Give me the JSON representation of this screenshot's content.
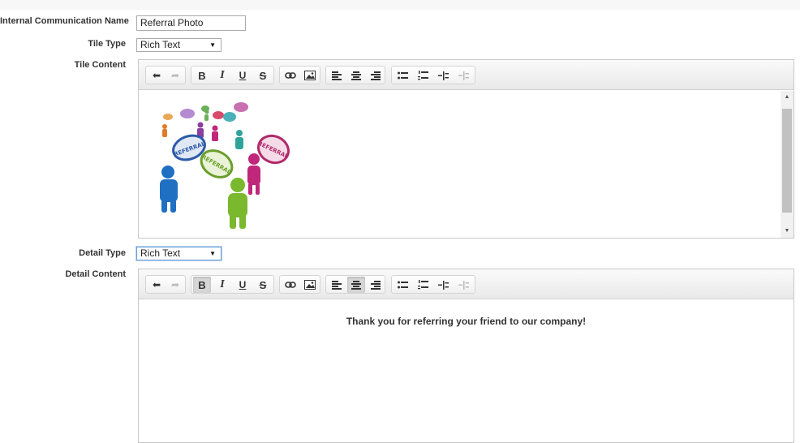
{
  "form": {
    "name_label": "Internal Communication Name",
    "name_value": "Referral Photo",
    "tile_type_label": "Tile Type",
    "tile_type_value": "Rich Text",
    "tile_content_label": "Tile Content",
    "detail_type_label": "Detail Type",
    "detail_type_value": "Rich Text",
    "detail_content_label": "Detail Content"
  },
  "detail_editor": {
    "text": "Thank you for referring your friend to our company!"
  },
  "image": {
    "bubbles": [
      "REFERRAL",
      "REFERRAL",
      "REFERRAL"
    ]
  },
  "colors": {
    "people": [
      "#1f6fc2",
      "#7ab82e",
      "#c0277a",
      "#2fa39a",
      "#e07b2a",
      "#8a3fa0"
    ]
  }
}
